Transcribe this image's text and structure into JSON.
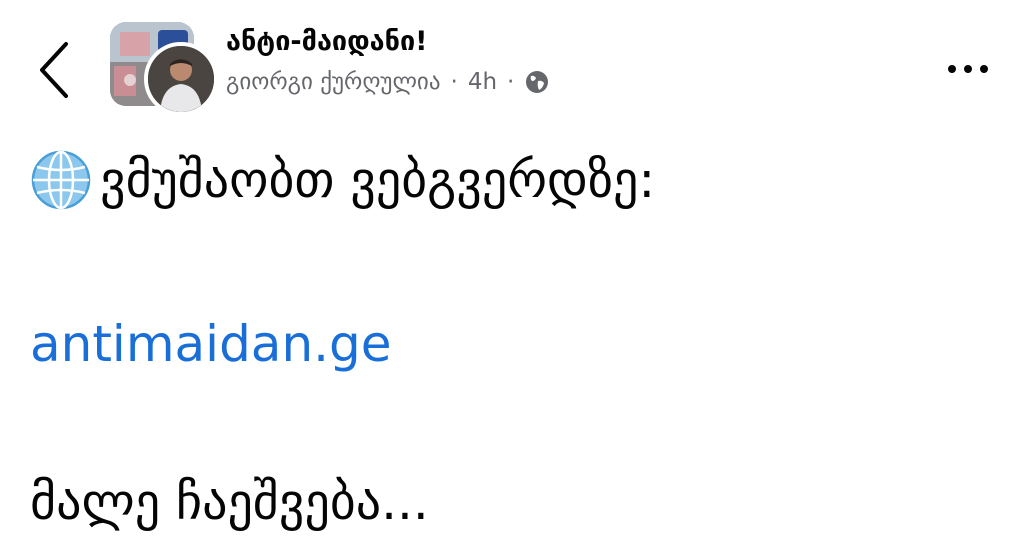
{
  "header": {
    "group_name": "ანტი-მაიდანი!",
    "author": "გიორგი ქურღულია",
    "separator": "·",
    "time": "4h"
  },
  "post": {
    "line1": "ვმუშაობთ ვებგვერდზე:",
    "link": "antimaidan.ge",
    "line3": "მალე ჩაეშვება..."
  },
  "icons": {
    "back": "chevron-left-icon",
    "audience": "globe-icon",
    "emoji": "globe-with-meridians-icon",
    "more": "more-dots-icon"
  },
  "colors": {
    "link": "#1a6ed8",
    "meta": "#65676b",
    "text": "#050505"
  }
}
